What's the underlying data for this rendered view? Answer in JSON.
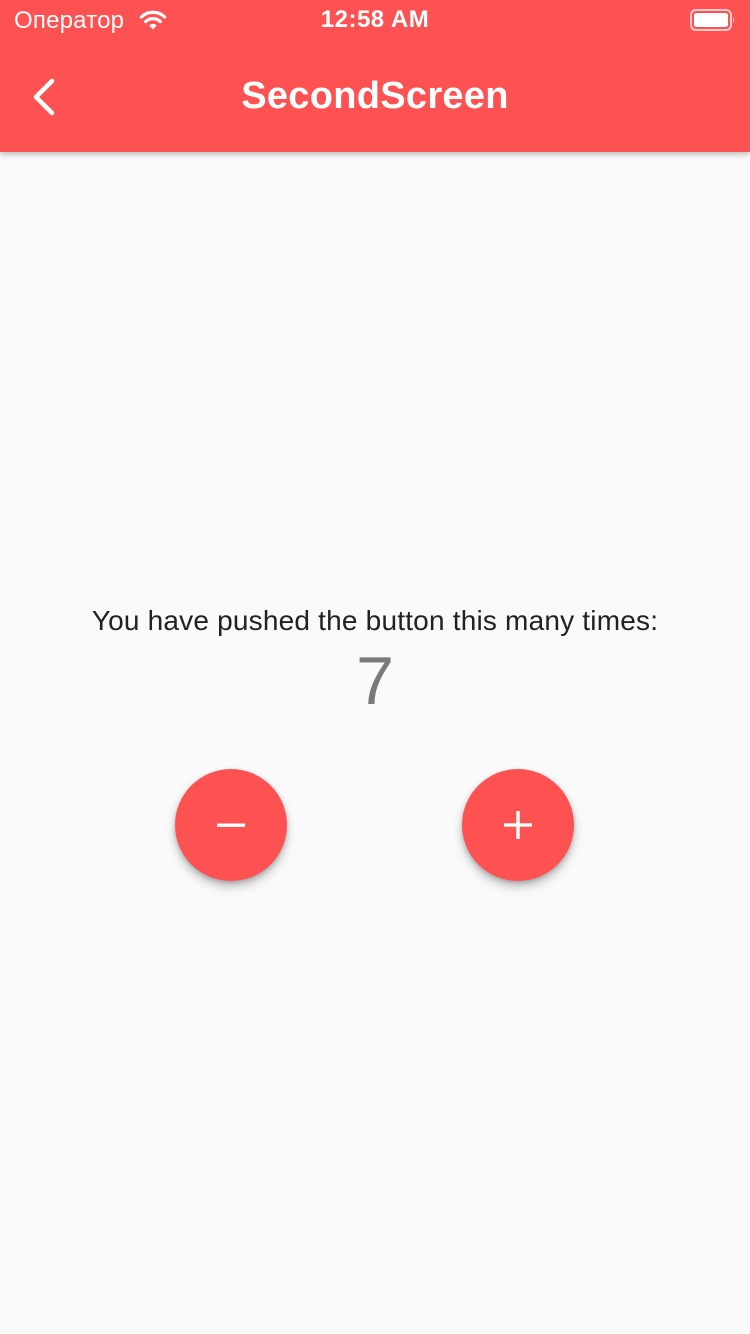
{
  "status_bar": {
    "carrier": "Оператор",
    "time": "12:58 AM",
    "wifi_icon": "wifi-icon",
    "battery_icon": "battery-icon"
  },
  "app_bar": {
    "title": "SecondScreen",
    "back_icon": "chevron-left-icon",
    "color": "#fe5252"
  },
  "counter": {
    "label": "You have pushed the button this many times:",
    "value": "7"
  },
  "actions": {
    "decrement_icon": "minus-icon",
    "increment_icon": "plus-icon"
  }
}
